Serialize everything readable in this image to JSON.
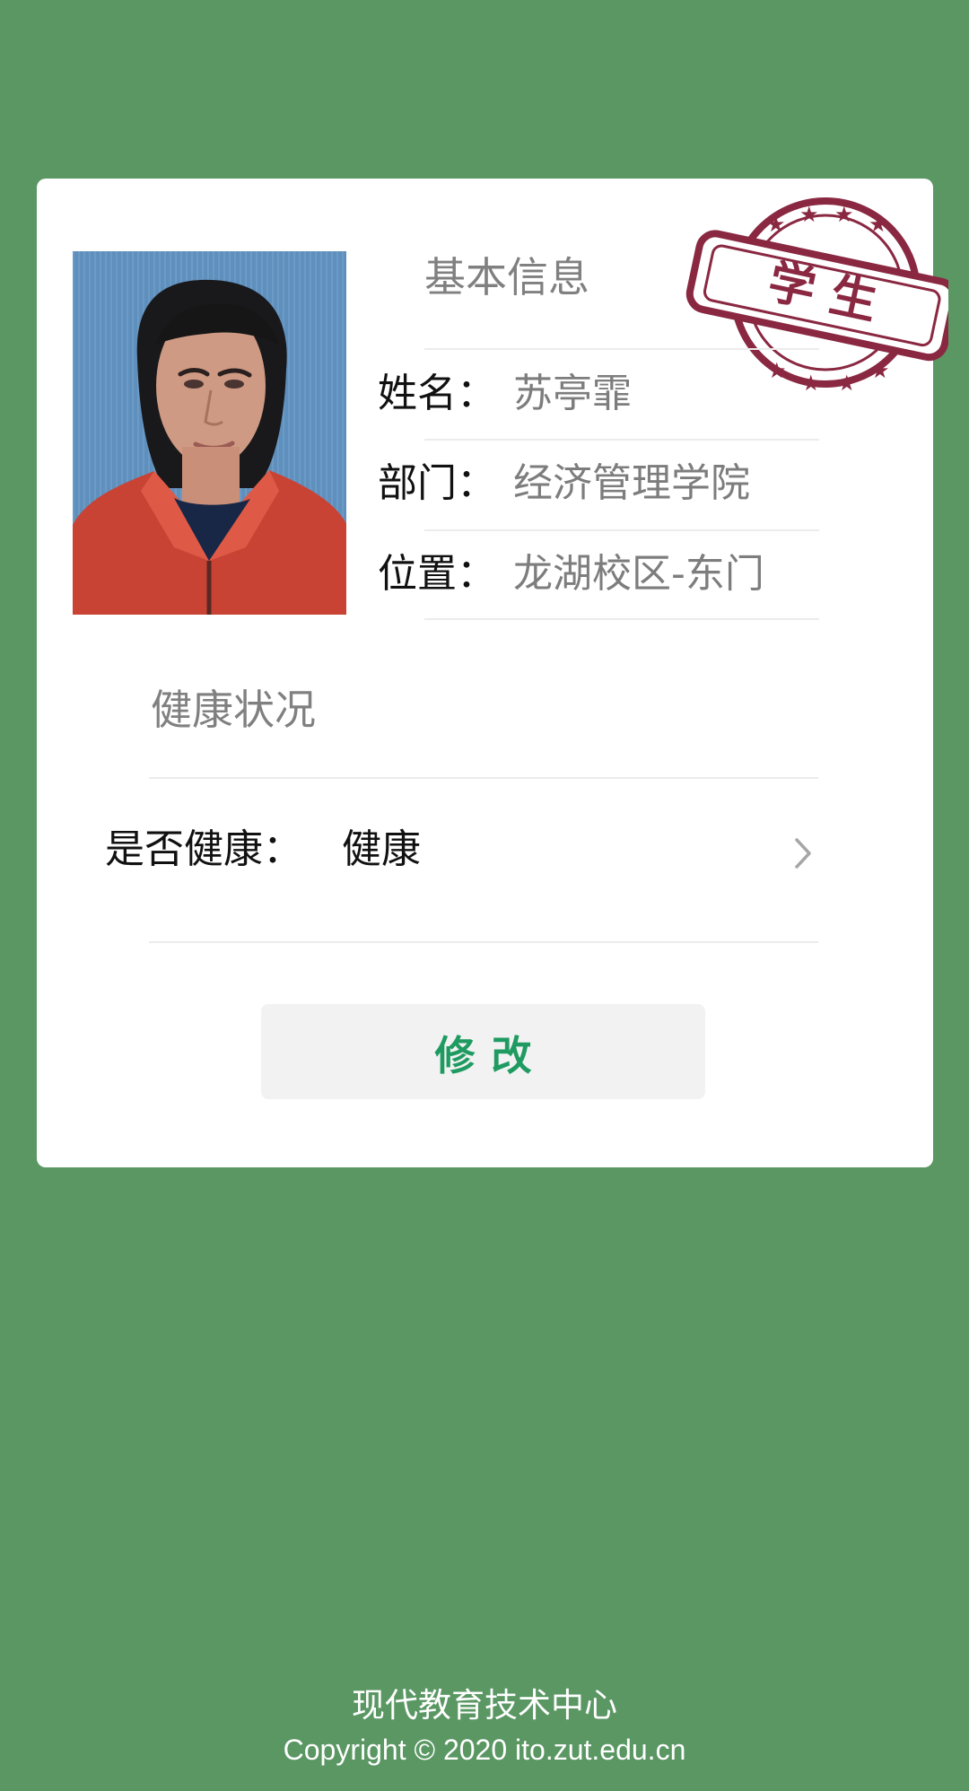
{
  "profile": {
    "photo_alt": "学生照片",
    "basic_info_title": "基本信息",
    "stamp_text": "学 生",
    "fields": [
      {
        "label": "姓名：",
        "value": "苏亭霏"
      },
      {
        "label": "部门：",
        "value": "经济管理学院"
      },
      {
        "label": "位置：",
        "value": "龙湖校区-东门"
      }
    ]
  },
  "health": {
    "title": "健康状况",
    "label": "是否健康：",
    "value": "健康"
  },
  "actions": {
    "edit_label": "修改"
  },
  "footer": {
    "title": "现代教育技术中心",
    "copyright": "Copyright © 2020 ito.zut.edu.cn"
  },
  "colors": {
    "page_background": "#5a9763",
    "card_background": "#ffffff",
    "button_text": "#1f9b62",
    "stamp": "#8a2842"
  }
}
